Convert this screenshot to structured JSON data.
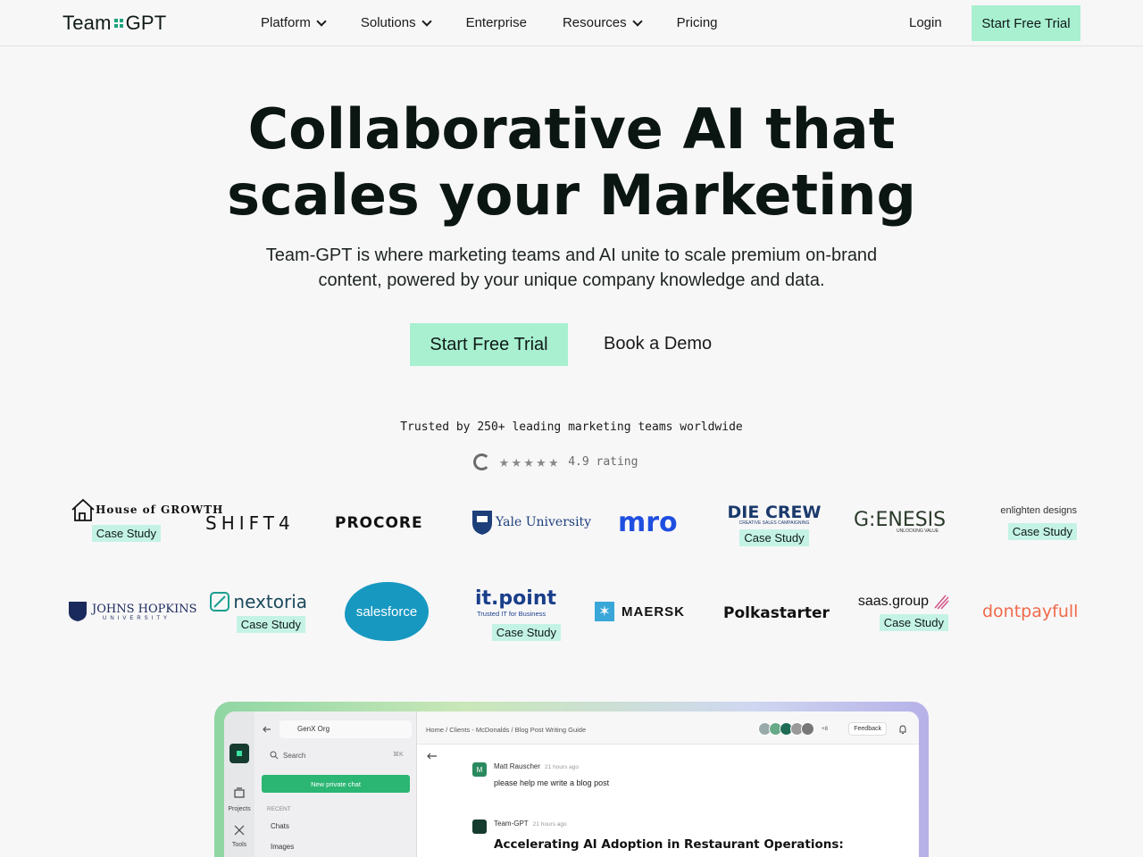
{
  "nav": {
    "brand_left": "Team",
    "brand_right": "GPT",
    "items": [
      {
        "label": "Platform",
        "dropdown": true
      },
      {
        "label": "Solutions",
        "dropdown": true
      },
      {
        "label": "Enterprise",
        "dropdown": false
      },
      {
        "label": "Resources",
        "dropdown": true
      },
      {
        "label": "Pricing",
        "dropdown": false
      }
    ],
    "login": "Login",
    "cta": "Start Free Trial"
  },
  "hero": {
    "title_line1": "Collaborative AI that",
    "title_line2": "scales your Marketing",
    "subtitle_line1": "Team-GPT is where marketing teams and AI unite to scale premium on-brand",
    "subtitle_line2": "content, powered by your unique company knowledge and data.",
    "cta": "Start Free Trial",
    "demo": "Book a Demo"
  },
  "trust": {
    "text": "Trusted by 250+ leading marketing teams worldwide",
    "stars": "★★★★★",
    "rating": "4.9 rating"
  },
  "logos": {
    "case_label": "Case Study",
    "row1": [
      "House of GROWTH",
      "SHIFT4",
      "PROCORE",
      "Yale University",
      "mro",
      "DIE CREW",
      "G:ENESIS",
      "enlighten designs"
    ],
    "row2": [
      "JOHNS HOPKINS",
      "nextoria",
      "salesforce",
      "it.point",
      "MAERSK",
      "Polkastarter",
      "saas.group",
      "dontpayfull"
    ],
    "sub_die_crew": "CREATIVE SALES CAMPAIGNING",
    "sub_genesis": "UNLOCKING VALUE",
    "sub_itpoint": "Trusted IT for Business",
    "sub_jh": "UNIVERSITY"
  },
  "app": {
    "org": "GenX Org",
    "search": "Search",
    "shortcut": "⌘K",
    "new_chat": "New private chat",
    "recent": "RECENT",
    "side_items": [
      "Chats",
      "Images"
    ],
    "rail": [
      "Projects",
      "Tools"
    ],
    "crumbs": [
      "Home",
      "Clients - McDonalds",
      "Blog Post Writing Guide"
    ],
    "feedback": "Feedback",
    "avatar_extra": "+8",
    "msg1_name": "Matt Rauscher",
    "msg1_time": "21 hours ago",
    "msg1_text": "please help me write a blog post",
    "msg2_name": "Team-GPT",
    "msg2_time": "21 hours ago",
    "msg2_head": "Accelerating AI Adoption in Restaurant Operations:"
  }
}
